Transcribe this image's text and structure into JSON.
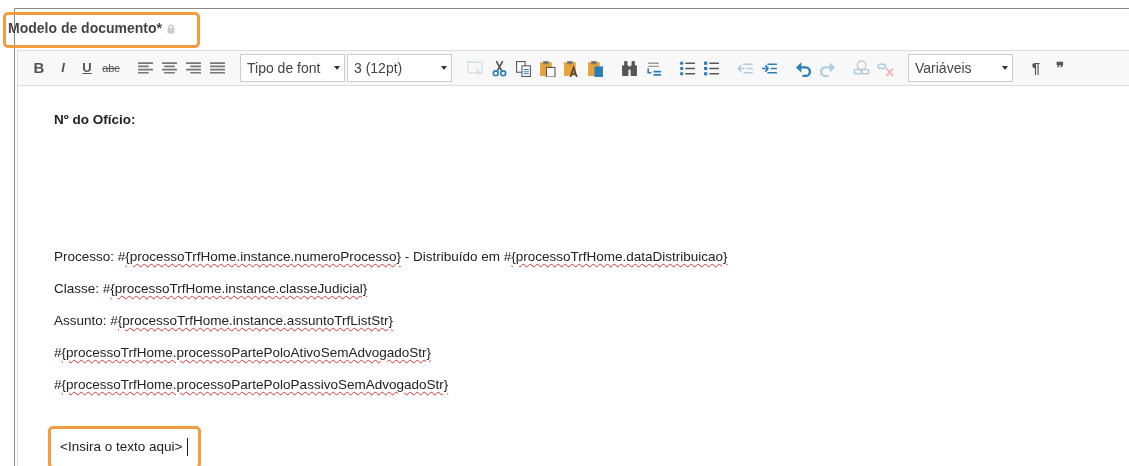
{
  "field": {
    "label": "Modelo de documento*",
    "locked": true,
    "highlighted": true
  },
  "toolbar": {
    "groups": [
      [
        {
          "kind": "bold",
          "label": "B"
        },
        {
          "kind": "italic",
          "label": "I"
        },
        {
          "kind": "underline",
          "label": "U"
        },
        {
          "kind": "strike",
          "label": "abc"
        }
      ],
      [
        {
          "kind": "icon",
          "disabled": false
        },
        {
          "kind": "icon",
          "disabled": false
        },
        {
          "kind": "icon",
          "disabled": false
        },
        {
          "kind": "icon",
          "disabled": false
        }
      ],
      [
        {
          "kind": "select",
          "value": "Tipo de font"
        },
        {
          "kind": "select",
          "value": "3 (12pt)"
        }
      ],
      [
        {
          "kind": "icon",
          "disabled": true
        },
        {
          "kind": "icon",
          "disabled": false
        },
        {
          "kind": "icon",
          "disabled": false
        },
        {
          "kind": "icon",
          "disabled": false
        },
        {
          "kind": "icon",
          "disabled": false
        },
        {
          "kind": "icon",
          "disabled": false
        }
      ],
      [
        {
          "kind": "icon",
          "disabled": false
        },
        {
          "kind": "icon",
          "disabled": false
        }
      ],
      [
        {
          "kind": "icon",
          "disabled": false
        },
        {
          "kind": "icon",
          "disabled": false
        }
      ],
      [
        {
          "kind": "icon",
          "disabled": true
        },
        {
          "kind": "icon",
          "disabled": false
        }
      ],
      [
        {
          "kind": "icon",
          "disabled": false
        },
        {
          "kind": "icon",
          "disabled": true
        }
      ],
      [
        {
          "kind": "icon",
          "disabled": true
        },
        {
          "kind": "icon",
          "disabled": true
        }
      ],
      [
        {
          "kind": "select",
          "value": "Variáveis"
        }
      ],
      [
        {
          "kind": "glyph",
          "label": "¶"
        },
        {
          "kind": "glyph",
          "label": "❞"
        }
      ]
    ]
  },
  "document": {
    "heading": "Nº do Ofício:",
    "lines": [
      [
        {
          "text": "Processo: #"
        },
        {
          "text": "{processoTrfHome.instance.numeroProcesso}",
          "misspelled": true
        },
        {
          "text": " - Distribuído em #"
        },
        {
          "text": "{processoTrfHome.dataDistribuicao}",
          "misspelled": true
        }
      ],
      [
        {
          "text": "Classe: #"
        },
        {
          "text": "{processoTrfHome.instance.classeJudicial}",
          "misspelled": true
        }
      ],
      [
        {
          "text": "Assunto: #"
        },
        {
          "text": "{processoTrfHome.instance.assuntoTrfListStr}",
          "misspelled": true
        }
      ],
      [
        {
          "text": "#"
        },
        {
          "text": "{processoTrfHome.processoPartePoloAtivoSemAdvogadoStr}",
          "misspelled": true
        }
      ],
      [
        {
          "text": "#"
        },
        {
          "text": "{processoTrfHome.processoPartePoloPassivoSemAdvogadoStr}",
          "misspelled": true
        }
      ]
    ],
    "placeholder": {
      "text": "<Insira o texto aqui>",
      "highlighted": true,
      "caret": true
    }
  }
}
